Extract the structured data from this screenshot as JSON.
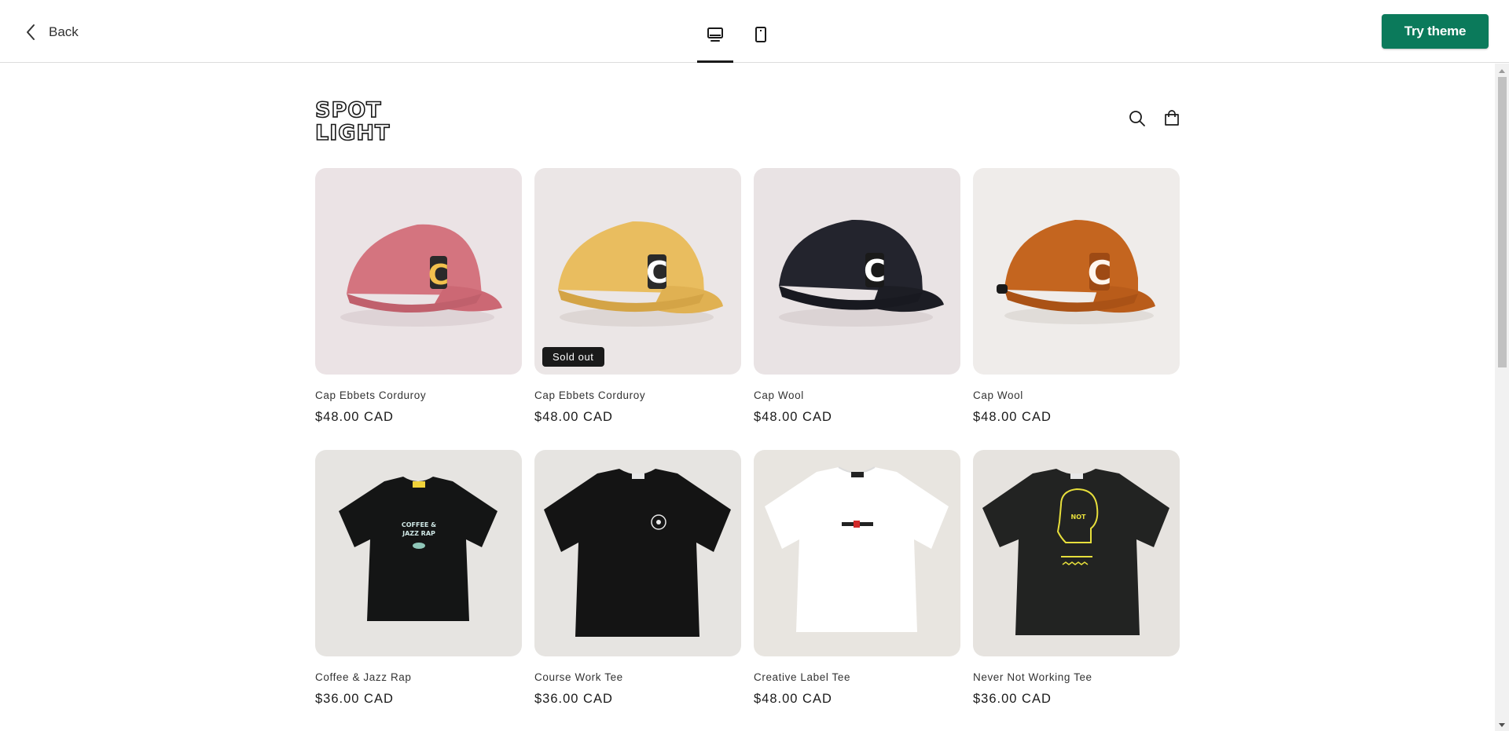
{
  "topbar": {
    "back_label": "Back",
    "devices": [
      {
        "name": "desktop-preview",
        "icon": "desktop-icon",
        "active": true
      },
      {
        "name": "mobile-preview",
        "icon": "mobile-icon",
        "active": false
      }
    ],
    "try_label": "Try theme",
    "try_color": "#0b7a5b"
  },
  "store": {
    "logo_text": [
      "SPOT",
      "LIGHT"
    ],
    "header_icons": [
      "search-icon",
      "cart-icon"
    ],
    "products": [
      {
        "name": "Cap Ebbets Corduroy",
        "price": "$48.00 CAD",
        "image": "pink-cap"
      },
      {
        "name": "Cap Ebbets Corduroy",
        "price": "$48.00 CAD",
        "image": "yellow-cap",
        "badge": "Sold out"
      },
      {
        "name": "Cap Wool",
        "price": "$48.00 CAD",
        "image": "black-cap"
      },
      {
        "name": "Cap Wool",
        "price": "$48.00 CAD",
        "image": "orange-cap"
      },
      {
        "name": "Coffee & Jazz Rap",
        "price": "$36.00 CAD",
        "image": "black-tee"
      },
      {
        "name": "Course Work Tee",
        "price": "$36.00 CAD",
        "image": "black-tee"
      },
      {
        "name": "Creative Label Tee",
        "price": "$48.00 CAD",
        "image": "white-tee"
      },
      {
        "name": "Never Not Working Tee",
        "price": "$36.00 CAD",
        "image": "black-tee"
      }
    ]
  }
}
